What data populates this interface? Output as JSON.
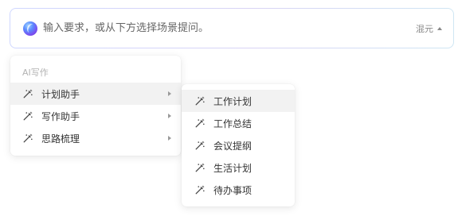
{
  "prompt": {
    "placeholder": "输入要求，或从下方选择场景提问。",
    "model_label": "混元",
    "logo_icon": "ai-orb-icon",
    "model_caret_icon": "caret-up-icon"
  },
  "menu": {
    "group_title": "AI写作",
    "item_icon": "magic-wand-icon",
    "submenu_icon": "chevron-right-icon",
    "items": [
      {
        "label": "计划助手",
        "active": true
      },
      {
        "label": "写作助手",
        "active": false
      },
      {
        "label": "思路梳理",
        "active": false
      }
    ]
  },
  "submenu": {
    "parent": "计划助手",
    "items": [
      {
        "label": "工作计划",
        "active": true
      },
      {
        "label": "工作总结",
        "active": false
      },
      {
        "label": "会议提纲",
        "active": false
      },
      {
        "label": "生活计划",
        "active": false
      },
      {
        "label": "待办事项",
        "active": false
      }
    ]
  },
  "colors": {
    "active_row": "#f2f2f2",
    "text": "#333333",
    "muted_text": "#b3b3b3",
    "input_border_gradient": [
      "#cfd7ff",
      "#d8d3f5",
      "#cfe6f3"
    ]
  }
}
